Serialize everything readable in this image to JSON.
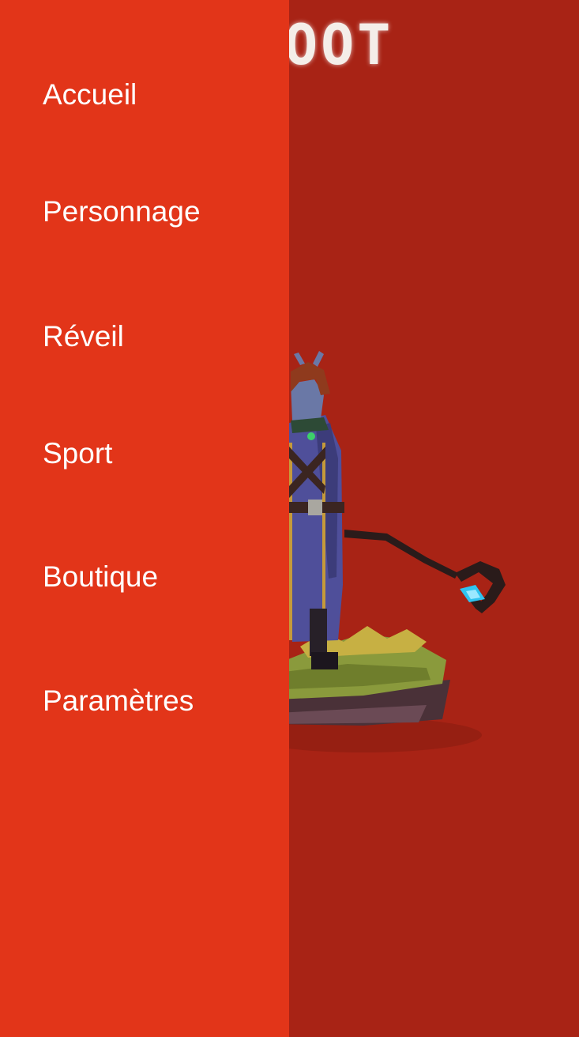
{
  "header": {
    "title_visible": "OOT"
  },
  "drawer": {
    "items": [
      {
        "label": "Accueil"
      },
      {
        "label": "Personnage"
      },
      {
        "label": "Réveil"
      },
      {
        "label": "Sport"
      },
      {
        "label": "Boutique"
      },
      {
        "label": "Paramètres"
      }
    ]
  },
  "colors": {
    "drawer_bg": "#e23519",
    "main_bg": "#a82315",
    "menu_text": "#ffffff",
    "title_text": "#f4eee9"
  },
  "illustration": {
    "icon": "pixel-art-mage-character"
  }
}
